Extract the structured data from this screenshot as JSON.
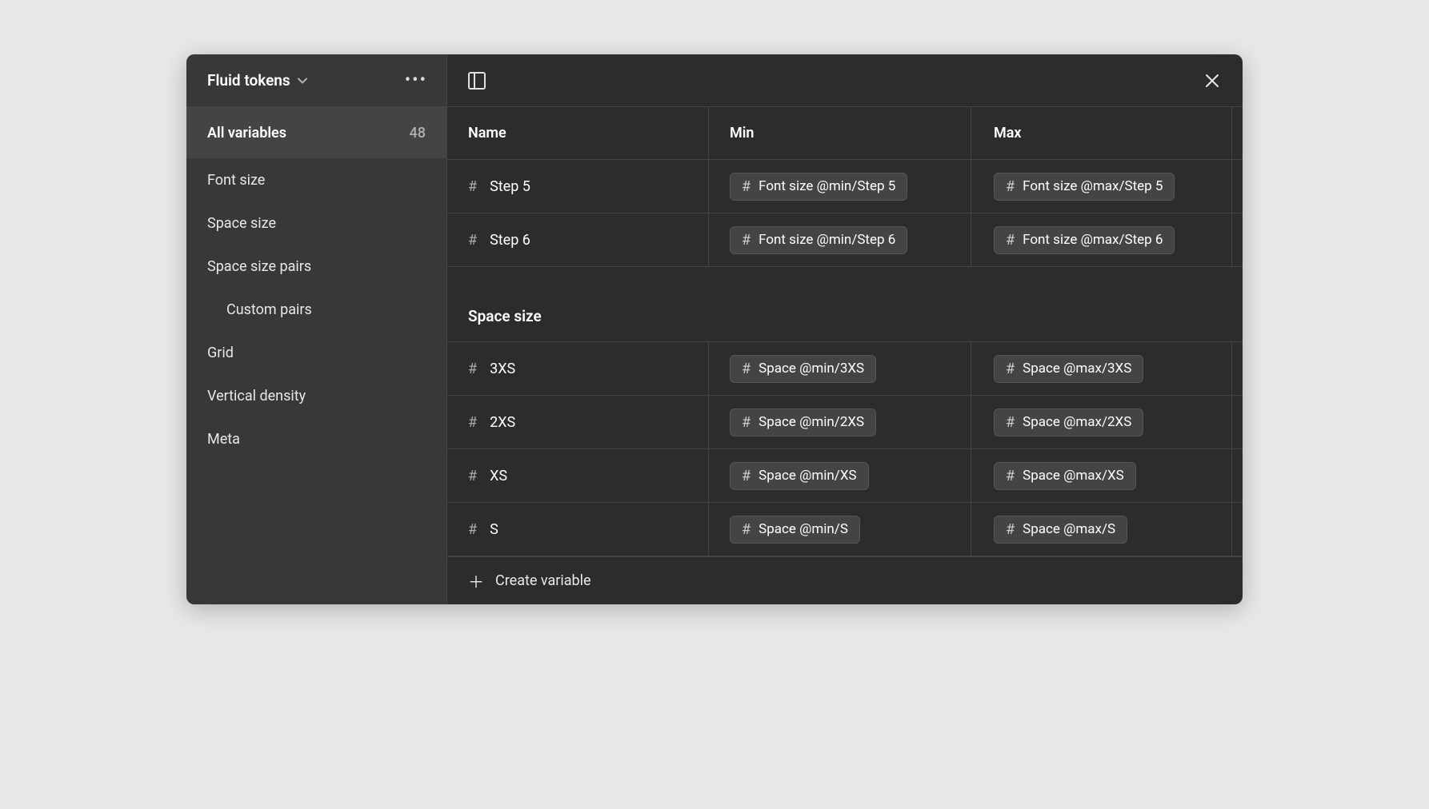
{
  "sidebar": {
    "collection_title": "Fluid tokens",
    "all_variables_label": "All variables",
    "all_variables_count": "48",
    "groups": [
      {
        "label": "Font size",
        "indent": false
      },
      {
        "label": "Space size",
        "indent": false
      },
      {
        "label": "Space size pairs",
        "indent": false
      },
      {
        "label": "Custom pairs",
        "indent": true
      },
      {
        "label": "Grid",
        "indent": false
      },
      {
        "label": "Vertical density",
        "indent": false
      },
      {
        "label": "Meta",
        "indent": false
      }
    ]
  },
  "columns": {
    "name": "Name",
    "min": "Min",
    "max": "Max"
  },
  "sections": [
    {
      "header": null,
      "rows": [
        {
          "name": "Step 5",
          "min": "Font size @min/Step 5",
          "max": "Font size @max/Step 5"
        },
        {
          "name": "Step 6",
          "min": "Font size @min/Step 6",
          "max": "Font size @max/Step 6"
        }
      ]
    },
    {
      "header": "Space size",
      "rows": [
        {
          "name": "3XS",
          "min": "Space @min/3XS",
          "max": "Space @max/3XS"
        },
        {
          "name": "2XS",
          "min": "Space @min/2XS",
          "max": "Space @max/2XS"
        },
        {
          "name": "XS",
          "min": "Space @min/XS",
          "max": "Space @max/XS"
        },
        {
          "name": "S",
          "min": "Space @min/S",
          "max": "Space @max/S"
        }
      ]
    }
  ],
  "footer": {
    "create_label": "Create variable"
  }
}
